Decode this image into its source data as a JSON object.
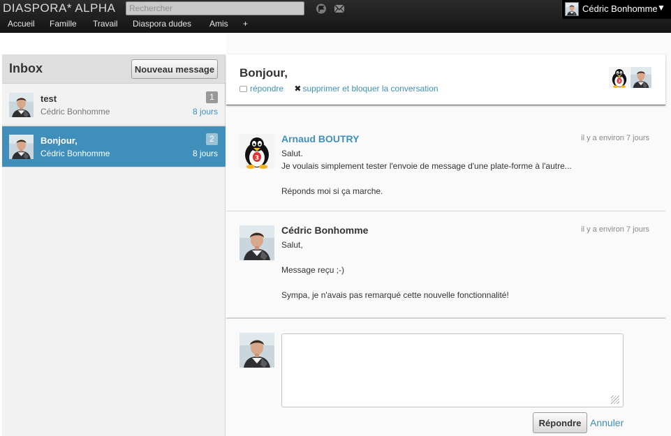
{
  "header": {
    "logo": "DIASPORA* ALPHA",
    "search_placeholder": "Rechercher",
    "user_name": "Cédric Bonhomme",
    "user_menu_caret": "▼",
    "nav": [
      "Accueil",
      "Famille",
      "Travail",
      "Diaspora dudes",
      "Amis",
      "+"
    ],
    "icons": [
      "notifications-icon",
      "messages-icon"
    ]
  },
  "inbox": {
    "title": "Inbox",
    "new_message_label": "Nouveau message",
    "conversations": [
      {
        "subject": "test",
        "author": "Cédric Bonhomme",
        "count": "1",
        "time": "8 jours",
        "selected": false
      },
      {
        "subject": "Bonjour,",
        "author": "Cédric Bonhomme",
        "count": "2",
        "time": "8 jours",
        "selected": true
      }
    ]
  },
  "conversation": {
    "title": "Bonjour,",
    "reply_link": "répondre",
    "delete_link": "supprimer et bloquer la conversation",
    "messages": [
      {
        "author": "Arnaud BOUTRY",
        "author_is_link": true,
        "time": "il y a environ 7 jours",
        "lines": [
          "Salut.",
          "Je voulais simplement tester l'envoie de message d'une plate-forme à l'autre...",
          "",
          "Réponds moi si ça marche."
        ]
      },
      {
        "author": "Cédric Bonhomme",
        "author_is_link": false,
        "time": "il y a environ 7 jours",
        "lines": [
          "Salut,",
          "",
          "Message reçu ;-)",
          "",
          "Sympa, je n'avais pas remarqué cette nouvelle fonctionnalité!"
        ]
      }
    ],
    "reply_button": "Répondre",
    "cancel_link": "Annuler"
  },
  "colors": {
    "accent": "#3f8fba",
    "header_bg": "#1f1f1f",
    "selected_row": "#3f8fba"
  }
}
